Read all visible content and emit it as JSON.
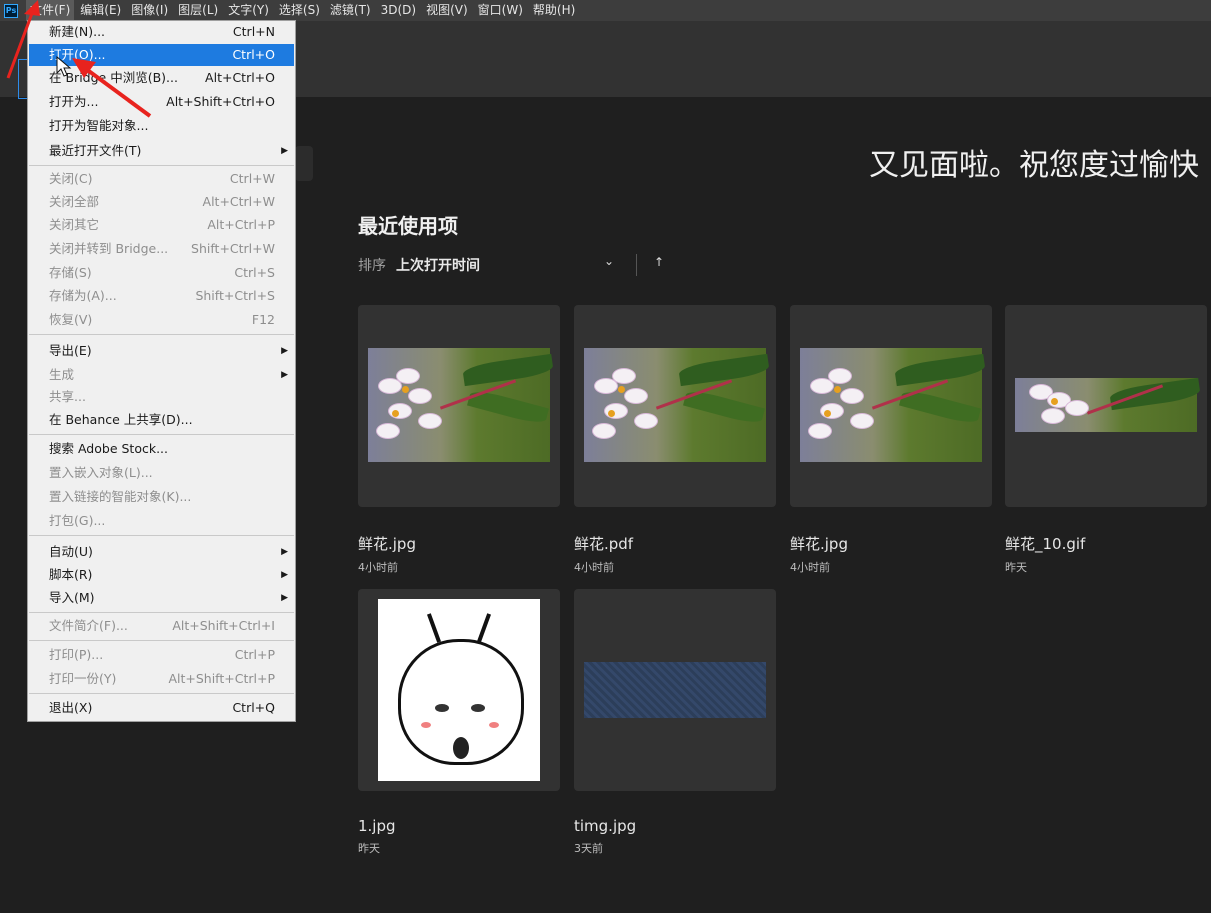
{
  "menubar": {
    "app_logo": "Ps",
    "items": [
      "文件(F)",
      "编辑(E)",
      "图像(I)",
      "图层(L)",
      "文字(Y)",
      "选择(S)",
      "滤镜(T)",
      "3D(D)",
      "视图(V)",
      "窗口(W)",
      "帮助(H)"
    ]
  },
  "welcome_text": "又见面啦。祝您度过愉快",
  "recent": {
    "title": "最近使用项",
    "sort_label": "排序",
    "sort_value": "上次打开时间"
  },
  "files": [
    {
      "name": "鲜花.jpg",
      "time": "4小时前"
    },
    {
      "name": "鲜花.pdf",
      "time": "4小时前"
    },
    {
      "name": "鲜花.jpg",
      "time": "4小时前"
    },
    {
      "name": "鲜花_10.gif",
      "time": "昨天"
    },
    {
      "name": "1.jpg",
      "time": "昨天"
    },
    {
      "name": "timg.jpg",
      "time": "3天前"
    }
  ],
  "file_menu": {
    "items": [
      {
        "label": "新建(N)...",
        "shortcut": "Ctrl+N"
      },
      {
        "label": "打开(O)...",
        "shortcut": "Ctrl+O"
      },
      {
        "label": "在 Bridge 中浏览(B)...",
        "shortcut": "Alt+Ctrl+O"
      },
      {
        "label": "打开为...",
        "shortcut": "Alt+Shift+Ctrl+O"
      },
      {
        "label": "打开为智能对象...",
        "shortcut": ""
      },
      {
        "label": "最近打开文件(T)",
        "shortcut": ""
      },
      {
        "label": "关闭(C)",
        "shortcut": "Ctrl+W"
      },
      {
        "label": "关闭全部",
        "shortcut": "Alt+Ctrl+W"
      },
      {
        "label": "关闭其它",
        "shortcut": "Alt+Ctrl+P"
      },
      {
        "label": "关闭并转到 Bridge...",
        "shortcut": "Shift+Ctrl+W"
      },
      {
        "label": "存储(S)",
        "shortcut": "Ctrl+S"
      },
      {
        "label": "存储为(A)...",
        "shortcut": "Shift+Ctrl+S"
      },
      {
        "label": "恢复(V)",
        "shortcut": "F12"
      },
      {
        "label": "导出(E)",
        "shortcut": ""
      },
      {
        "label": "生成",
        "shortcut": ""
      },
      {
        "label": "共享...",
        "shortcut": ""
      },
      {
        "label": "在 Behance 上共享(D)...",
        "shortcut": ""
      },
      {
        "label": "搜索 Adobe Stock...",
        "shortcut": ""
      },
      {
        "label": "置入嵌入对象(L)...",
        "shortcut": ""
      },
      {
        "label": "置入链接的智能对象(K)...",
        "shortcut": ""
      },
      {
        "label": "打包(G)...",
        "shortcut": ""
      },
      {
        "label": "自动(U)",
        "shortcut": ""
      },
      {
        "label": "脚本(R)",
        "shortcut": ""
      },
      {
        "label": "导入(M)",
        "shortcut": ""
      },
      {
        "label": "文件简介(F)...",
        "shortcut": "Alt+Shift+Ctrl+I"
      },
      {
        "label": "打印(P)...",
        "shortcut": "Ctrl+P"
      },
      {
        "label": "打印一份(Y)",
        "shortcut": "Alt+Shift+Ctrl+P"
      },
      {
        "label": "退出(X)",
        "shortcut": "Ctrl+Q"
      }
    ]
  },
  "colors": {
    "accent": "#1e7be0",
    "annotation": "#e8231e"
  }
}
